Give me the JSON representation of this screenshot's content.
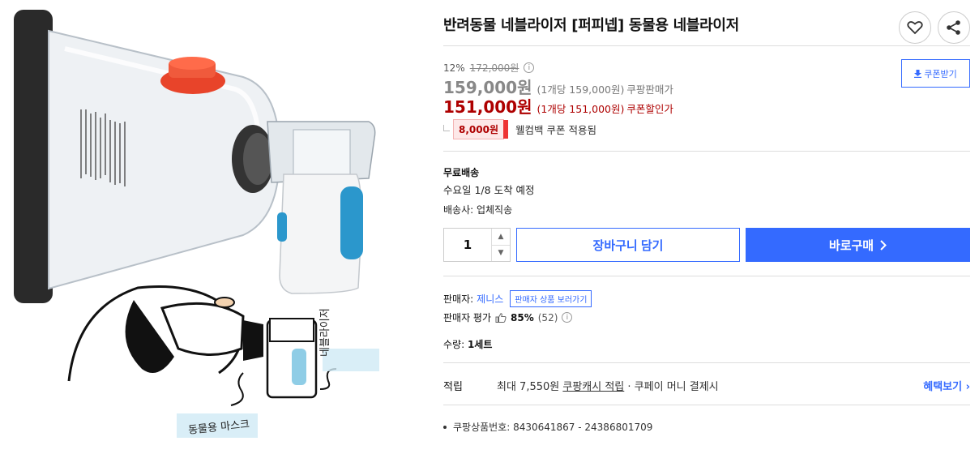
{
  "product": {
    "title": "반려동물 네블라이저 [퍼피넵] 동물용 네블라이저",
    "image_labels": {
      "nebulizer_label": "네블라이저",
      "mask_label": "동물용 마스크"
    }
  },
  "price": {
    "discount_rate": "12%",
    "original_price": "172,000원",
    "info_icon": "info-icon",
    "seller_price": "159,000원",
    "seller_price_unit": "(1개당 159,000원)",
    "seller_price_label": "쿠팡판매가",
    "coupon_price": "151,000원",
    "coupon_price_unit": "(1개당 151,000원)",
    "coupon_price_label": "쿠폰할인가",
    "coupon_button": "쿠폰받기"
  },
  "welcome": {
    "badge": "8,000원",
    "text": "웰컴백 쿠폰 적용됨"
  },
  "shipping": {
    "label": "무료배송",
    "date": "수요일 1/8 도착 예정",
    "carrier": "배송사: 업체직송"
  },
  "purchase": {
    "quantity": "1",
    "cart_button": "장바구니 담기",
    "buy_button": "바로구매"
  },
  "seller": {
    "label": "판매자:",
    "name": "제니스",
    "view_products": "판매자 상품 보러가기",
    "rating_label": "판매자 평가",
    "rating_percent": "85%",
    "rating_count": "(52)"
  },
  "quantity_info": {
    "label": "수량:",
    "value": "1세트"
  },
  "reward": {
    "label": "적립",
    "prefix": "최대 7,550원",
    "cash_link": "쿠팡캐시 적립",
    "suffix": "· 쿠페이 머니 결제시",
    "benefit_link": "혜택보기"
  },
  "product_code": "쿠팡상품번호: 8430641867 - 24386801709",
  "colors": {
    "accent": "#346aff",
    "discount_red": "#ae0000"
  }
}
